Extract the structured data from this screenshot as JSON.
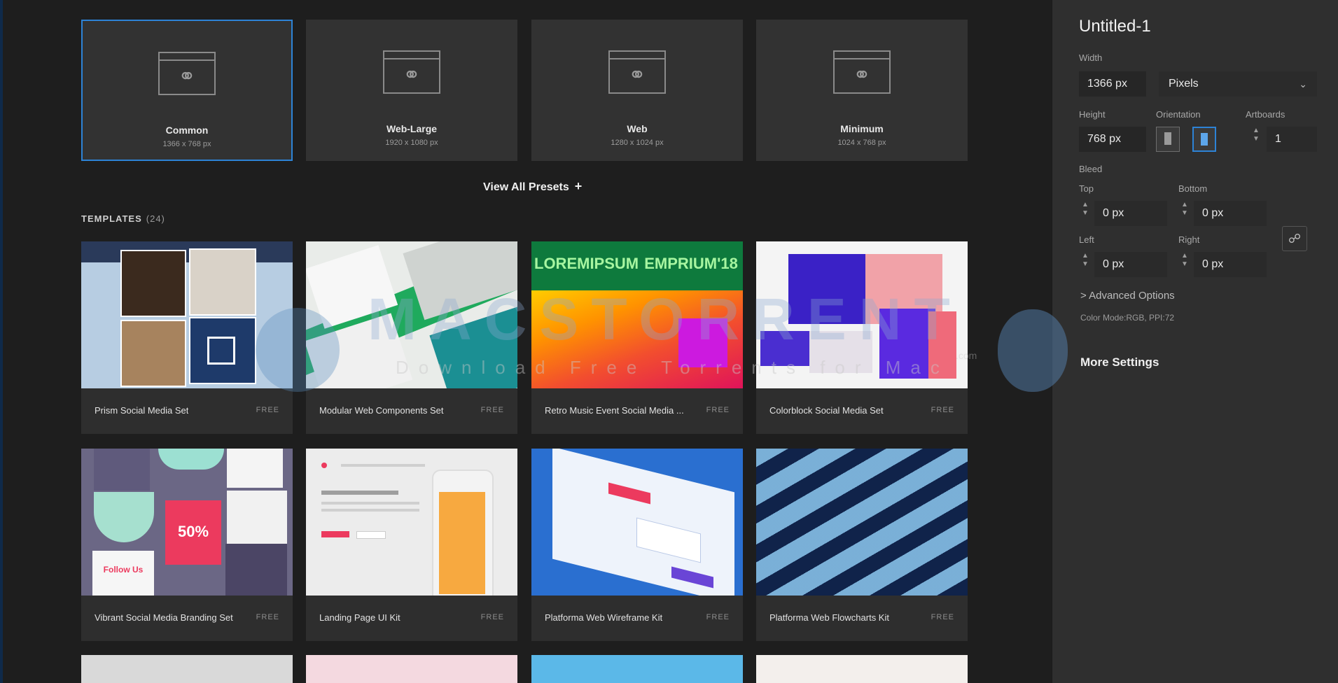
{
  "presets": {
    "heading": "",
    "items": [
      {
        "name": "Common",
        "size": "1366 x 768 px",
        "selected": true
      },
      {
        "name": "Web-Large",
        "size": "1920 x 1080 px",
        "selected": false
      },
      {
        "name": "Web",
        "size": "1280 x 1024 px",
        "selected": false
      },
      {
        "name": "Minimum",
        "size": "1024 x 768 px",
        "selected": false
      }
    ],
    "view_all": "View All Presets",
    "view_all_icon": "+"
  },
  "templates": {
    "heading": "TEMPLATES",
    "count": "(24)",
    "items": [
      {
        "name": "Prism Social Media Set",
        "tag": "FREE"
      },
      {
        "name": "Modular Web Components Set",
        "tag": "FREE"
      },
      {
        "name": "Retro Music Event Social Media ...",
        "tag": "FREE"
      },
      {
        "name": "Colorblock Social Media Set",
        "tag": "FREE"
      },
      {
        "name": "Vibrant Social Media Branding Set",
        "tag": "FREE"
      },
      {
        "name": "Landing Page UI Kit",
        "tag": "FREE"
      },
      {
        "name": "Platforma Web Wireframe Kit",
        "tag": "FREE"
      },
      {
        "name": "Platforma Web Flowcharts Kit",
        "tag": "FREE"
      }
    ],
    "retro_thumb_text": "LOREMIPSUM EMPRIUM'18",
    "vibrant_thumb_text": "50%",
    "vibrant_follow": "Follow Us"
  },
  "panel": {
    "title": "Untitled-1",
    "width_label": "Width",
    "width_value": "1366 px",
    "unit_value": "Pixels",
    "height_label": "Height",
    "height_value": "768 px",
    "orientation_label": "Orientation",
    "artboards_label": "Artboards",
    "artboards_value": "1",
    "bleed_label": "Bleed",
    "top_label": "Top",
    "top_value": "0 px",
    "bottom_label": "Bottom",
    "bottom_value": "0 px",
    "left_label": "Left",
    "left_value": "0 px",
    "right_label": "Right",
    "right_value": "0 px",
    "advanced": "> Advanced Options",
    "color_mode": "Color Mode:RGB, PPI:72",
    "more_settings": "More Settings"
  },
  "watermark": {
    "title": "MACSTORRENT",
    "subtitle": "Download Free Torrents for Mac",
    "domain": ".com"
  },
  "colors": {
    "accent": "#2d83d6",
    "panel_bg": "#2f2f2f",
    "main_bg": "#1e1e1e"
  }
}
